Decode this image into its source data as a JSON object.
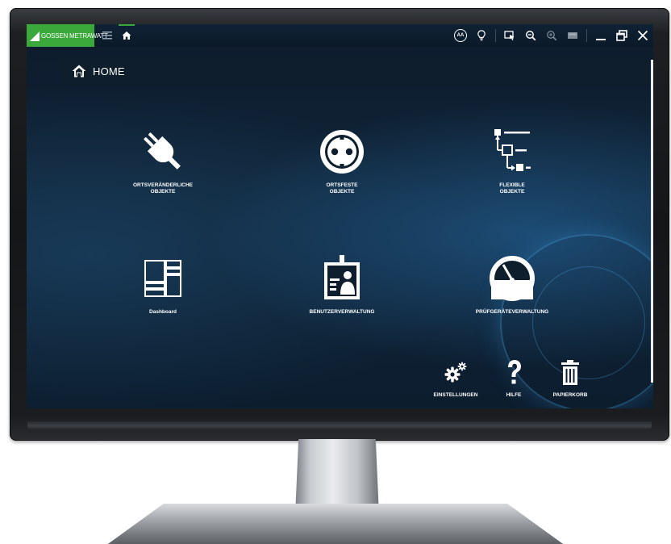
{
  "app": {
    "brand": "GOSSEN METRAWATT",
    "brand_color": "#3aa83a"
  },
  "titlebar": {
    "left_icons": [
      "menu-icon",
      "home-icon"
    ],
    "right_icons": [
      "text-size-icon",
      "lightbulb-icon",
      "select-icon",
      "zoom-out-icon",
      "zoom-in-icon",
      "screen-icon",
      "minimize-icon",
      "restore-icon",
      "close-icon"
    ],
    "text_size_label": "AA"
  },
  "header": {
    "title": "HOME",
    "icon": "home-icon"
  },
  "tiles": [
    {
      "label": "ORTSVERÄNDERLICHE\nOBJEKTE",
      "icon": "plug-icon"
    },
    {
      "label": "ORTSFESTE\nOBJEKTE",
      "icon": "socket-icon"
    },
    {
      "label": "FLEXIBLE\nOBJEKTE",
      "icon": "tree-structure-icon"
    },
    {
      "label": "Dashboard",
      "icon": "dashboard-icon"
    },
    {
      "label": "BENUTZERVERWALTUNG",
      "icon": "user-badge-icon"
    },
    {
      "label": "PRÜFGERÄTEVERWALTUNG",
      "icon": "gauge-icon"
    }
  ],
  "footer_actions": [
    {
      "label": "EINSTELLUNGEN",
      "icon": "gears-icon"
    },
    {
      "label": "HILFE",
      "icon": "question-icon"
    },
    {
      "label": "PAPIERKORB",
      "icon": "trash-icon"
    }
  ]
}
